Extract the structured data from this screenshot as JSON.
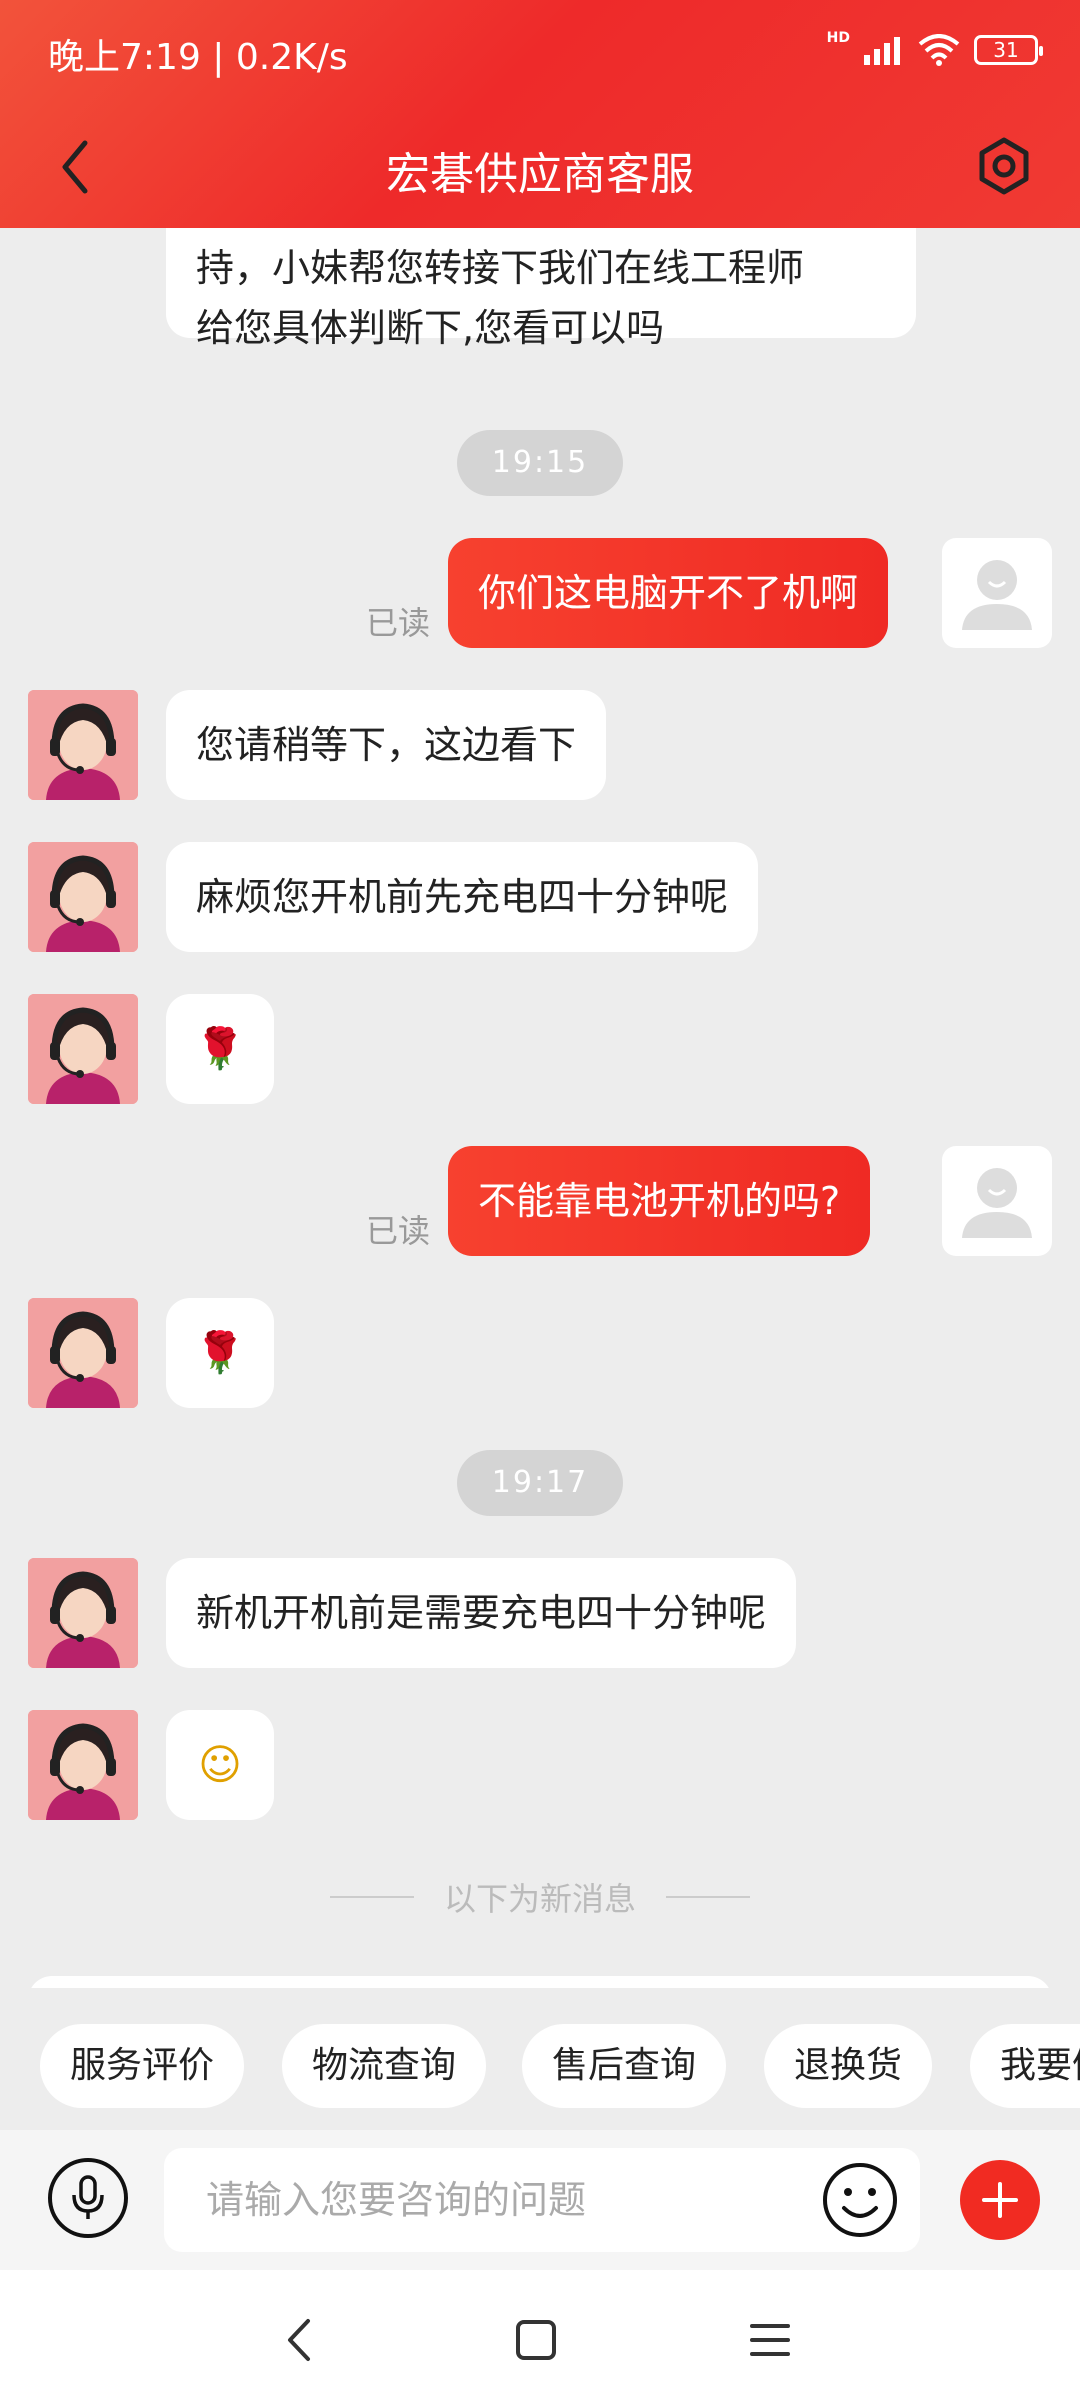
{
  "status_bar": {
    "time": "晚上7:19 | 0.2K/s",
    "network_badge": "HD",
    "battery": "31"
  },
  "header": {
    "title": "宏碁供应商客服"
  },
  "messages": {
    "m0": "持，小妹帮您转接下我们在线工程师\n给您具体判断下,您看可以吗",
    "t1": "19:15",
    "m1": "你们这电脑开不了机啊",
    "r1": "已读",
    "m2": "您请稍等下，这边看下",
    "m3": "麻烦您开机前先充电四十分钟呢",
    "m4_emoji": "🌹",
    "m5": "不能靠电池开机的吗?",
    "r5": "已读",
    "m6_emoji": "🌹",
    "t2": "19:17",
    "m7": "新机开机前是需要充电四十分钟呢",
    "m8_emoji": "☺",
    "divider": "以下为新消息"
  },
  "chips": [
    "服务评价",
    "物流查询",
    "售后查询",
    "退换货",
    "我要催"
  ],
  "input": {
    "placeholder": "请输入您要咨询的问题"
  },
  "colors": {
    "accent": "#f0342a",
    "background": "#ededed"
  }
}
